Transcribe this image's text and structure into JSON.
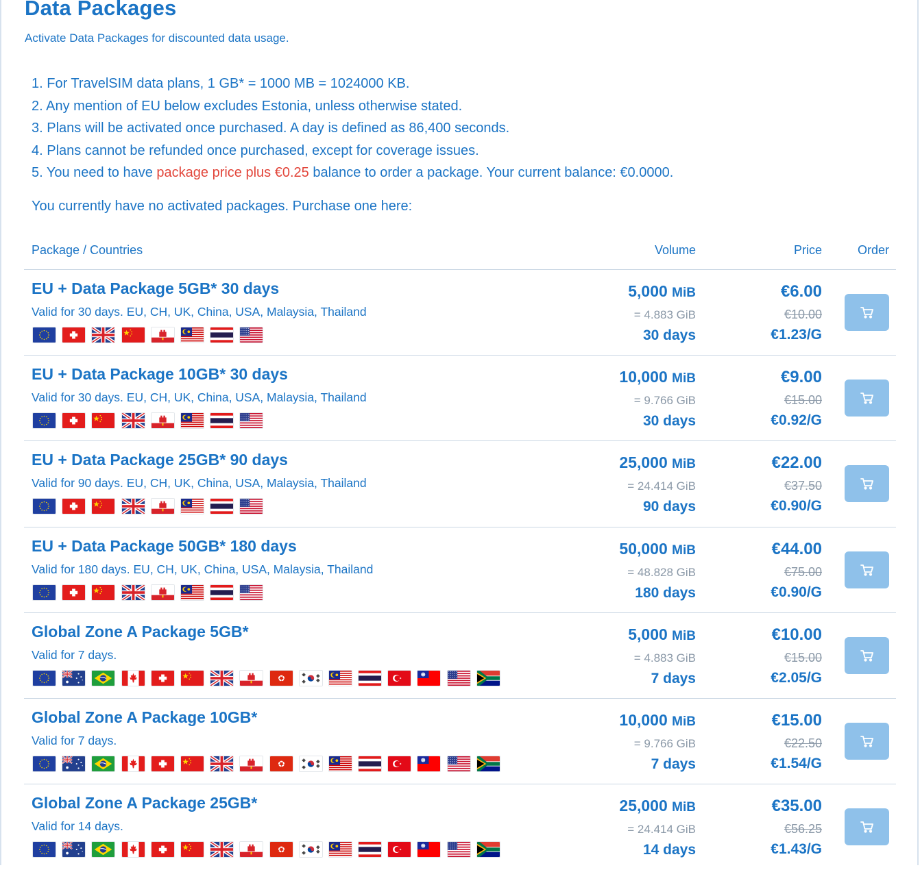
{
  "page": {
    "title": "Data Packages",
    "subtitle": "Activate Data Packages for discounted data usage.",
    "notes": [
      "1. For TravelSIM data plans, 1 GB* = 1000 MB = 1024000 KB.",
      "2. Any mention of EU below excludes Estonia, unless otherwise stated.",
      "3. Plans will be activated once purchased. A day is defined as 86,400 seconds.",
      "4. Plans cannot be refunded once purchased, except for coverage issues."
    ],
    "note5": {
      "prefix": "5. You need to have ",
      "highlight": "package price plus €0.25",
      "suffix": " balance to order a package. Your current balance: €0.0000."
    },
    "intro": "You currently have no activated packages. Purchase one here:",
    "colors": {
      "primary": "#1b74c5",
      "muted": "#8a98a7",
      "highlight": "#e2453a",
      "cart_button": "#8fc1ea",
      "divider": "#c9d6e3"
    }
  },
  "table": {
    "headers": {
      "package": "Package / Countries",
      "volume": "Volume",
      "price": "Price",
      "order": "Order"
    },
    "rows": [
      {
        "name": "EU + Data Package 5GB* 30 days",
        "valid": "Valid for 30 days. EU, CH, UK, China, USA, Malaysia, Thailand",
        "volume": "5,000",
        "unit": "MiB",
        "gib": "= 4.883 GiB",
        "days": "30 days",
        "price": "€6.00",
        "old_price": "€10.00",
        "per_gb": "€1.23/G",
        "flags": [
          "eu",
          "ch",
          "uk",
          "cn",
          "gi",
          "my",
          "th",
          "us"
        ]
      },
      {
        "name": "EU + Data Package 10GB* 30 days",
        "valid": "Valid for 30 days. EU, CH, UK, China, USA, Malaysia, Thailand",
        "volume": "10,000",
        "unit": "MiB",
        "gib": "= 9.766 GiB",
        "days": "30 days",
        "price": "€9.00",
        "old_price": "€15.00",
        "per_gb": "€0.92/G",
        "flags": [
          "eu",
          "ch",
          "cn",
          "uk",
          "gi",
          "my",
          "th",
          "us"
        ]
      },
      {
        "name": "EU + Data Package 25GB* 90 days",
        "valid": "Valid for 90 days. EU, CH, UK, China, USA, Malaysia, Thailand",
        "volume": "25,000",
        "unit": "MiB",
        "gib": "= 24.414 GiB",
        "days": "90 days",
        "price": "€22.00",
        "old_price": "€37.50",
        "per_gb": "€0.90/G",
        "flags": [
          "eu",
          "ch",
          "cn",
          "uk",
          "gi",
          "my",
          "th",
          "us"
        ]
      },
      {
        "name": "EU + Data Package 50GB* 180 days",
        "valid": "Valid for 180 days. EU, CH, UK, China, USA, Malaysia, Thailand",
        "volume": "50,000",
        "unit": "MiB",
        "gib": "= 48.828 GiB",
        "days": "180 days",
        "price": "€44.00",
        "old_price": "€75.00",
        "per_gb": "€0.90/G",
        "flags": [
          "eu",
          "ch",
          "cn",
          "uk",
          "gi",
          "my",
          "th",
          "us"
        ]
      },
      {
        "name": "Global Zone A Package 5GB*",
        "valid": "Valid for 7 days.",
        "volume": "5,000",
        "unit": "MiB",
        "gib": "= 4.883 GiB",
        "days": "7 days",
        "price": "€10.00",
        "old_price": "€15.00",
        "per_gb": "€2.05/G",
        "flags": [
          "eu",
          "au",
          "br",
          "ca",
          "ch",
          "cn",
          "uk",
          "gi",
          "hk",
          "kr",
          "my",
          "th",
          "tr",
          "tw",
          "us",
          "za"
        ]
      },
      {
        "name": "Global Zone A Package 10GB*",
        "valid": "Valid for 7 days.",
        "volume": "10,000",
        "unit": "MiB",
        "gib": "= 9.766 GiB",
        "days": "7 days",
        "price": "€15.00",
        "old_price": "€22.50",
        "per_gb": "€1.54/G",
        "flags": [
          "eu",
          "au",
          "br",
          "ca",
          "ch",
          "cn",
          "uk",
          "gi",
          "hk",
          "kr",
          "my",
          "th",
          "tr",
          "tw",
          "us",
          "za"
        ]
      },
      {
        "name": "Global Zone A Package 25GB*",
        "valid": "Valid for 14 days.",
        "volume": "25,000",
        "unit": "MiB",
        "gib": "= 24.414 GiB",
        "days": "14 days",
        "price": "€35.00",
        "old_price": "€56.25",
        "per_gb": "€1.43/G",
        "flags": [
          "eu",
          "au",
          "br",
          "ca",
          "ch",
          "cn",
          "uk",
          "gi",
          "hk",
          "kr",
          "my",
          "th",
          "tr",
          "tw",
          "us",
          "za"
        ]
      }
    ]
  }
}
